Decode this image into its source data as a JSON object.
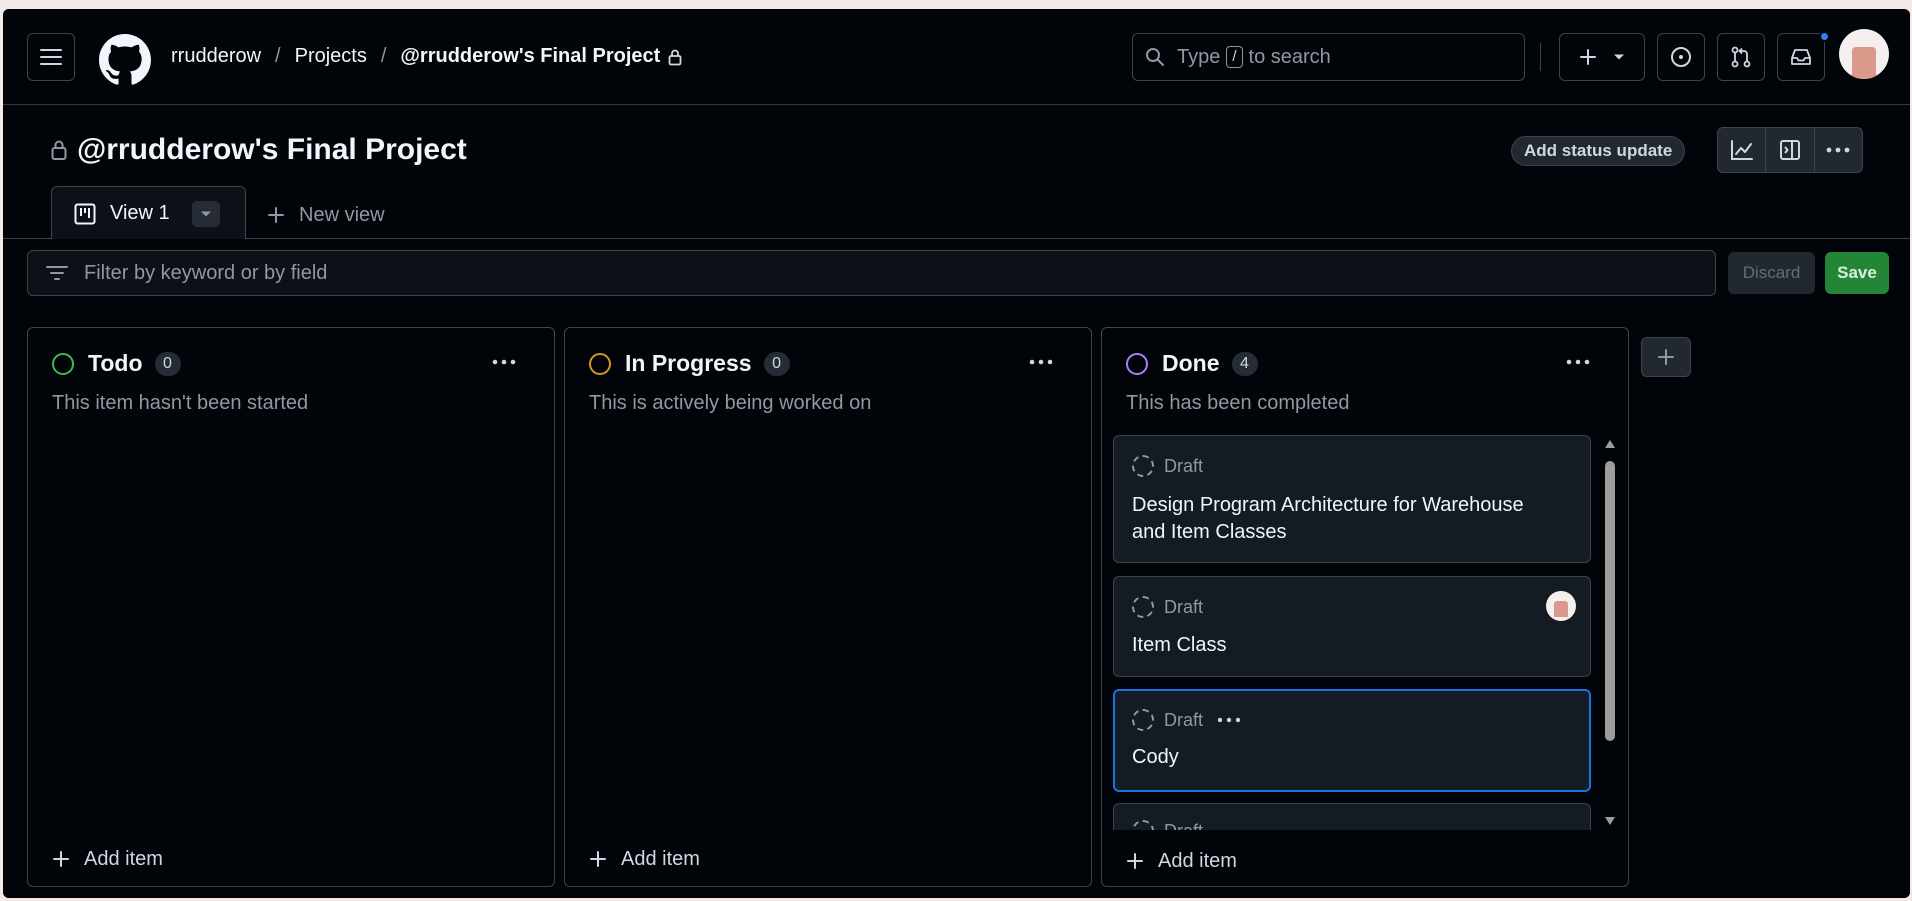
{
  "breadcrumbs": {
    "owner": "rrudderow",
    "section": "Projects",
    "project": "@rrudderow's Final Project"
  },
  "search": {
    "prefix": "Type",
    "key": "/",
    "suffix": "to search"
  },
  "project": {
    "title": "@rrudderow's Final Project",
    "status_button": "Add status update"
  },
  "tabs": {
    "active": "View 1",
    "new_view": "New view"
  },
  "filter": {
    "placeholder": "Filter by keyword or by field",
    "discard": "Discard",
    "save": "Save"
  },
  "columns": [
    {
      "name": "Todo",
      "count": "0",
      "description": "This item hasn't been started",
      "color": "#3fb950",
      "add_label": "Add item"
    },
    {
      "name": "In Progress",
      "count": "0",
      "description": "This is actively being worked on",
      "color": "#d29922",
      "add_label": "Add item"
    },
    {
      "name": "Done",
      "count": "4",
      "description": "This has been completed",
      "color": "#ab7df8",
      "add_label": "Add item"
    }
  ],
  "cards": [
    {
      "status": "Draft",
      "title": "Design Program Architecture for Warehouse and Item Classes"
    },
    {
      "status": "Draft",
      "title": "Item Class"
    },
    {
      "status": "Draft",
      "title": "Cody"
    },
    {
      "status": "Draft",
      "title": ""
    }
  ],
  "colors": {
    "accent": "#1f6feb",
    "save": "#238636",
    "background": "#010409"
  }
}
